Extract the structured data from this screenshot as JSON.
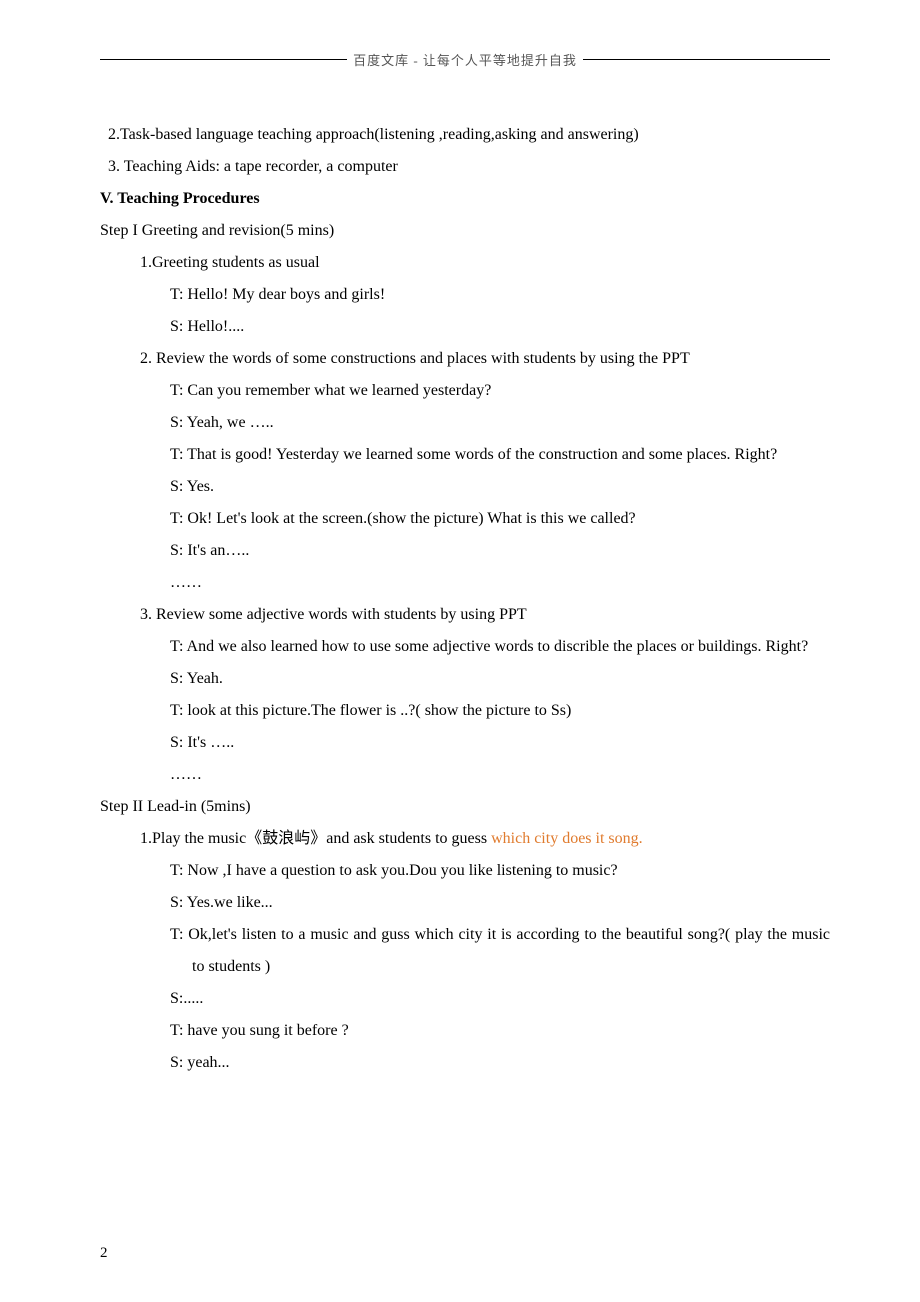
{
  "header": {
    "text": "百度文库 - 让每个人平等地提升自我"
  },
  "lines": {
    "l2": "2.Task-based language teaching approach(listening ,reading,asking and answering)",
    "l3": "3. Teaching Aids: a tape recorder, a computer",
    "sectionV": "V. Teaching Procedures",
    "step1": "Step I    Greeting and revision(5 mins)",
    "s1_1": "1.Greeting students as usual",
    "s1_1_t": "T: Hello! My dear boys and girls!",
    "s1_1_s": "S: Hello!....",
    "s1_2": "2. Review the words of some constructions and places with students by using the PPT",
    "s1_2_t1": "T: Can you remember what we learned yesterday?",
    "s1_2_s1": "S: Yeah, we …..",
    "s1_2_t2": "T: That is good! Yesterday we learned some words of the construction and some places. Right?",
    "s1_2_s2": "S: Yes.",
    "s1_2_t3": "T: Ok! Let's look at the screen.(show the picture)    What is this we called?",
    "s1_2_s3": "S: It's an…..",
    "s1_2_dots": "……",
    "s1_3": "3. Review some adjective words with students by using PPT",
    "s1_3_t1": "T: And we also learned how to use some adjective words to discrible the places or buildings. Right?",
    "s1_3_s1": "S: Yeah.",
    "s1_3_t2": "T: look at this picture.The flower is ..?( show the picture to Ss)",
    "s1_3_s2": "S: It's …..",
    "s1_3_dots": "……",
    "step2": "Step II    Lead-in (5mins)",
    "s2_1_a": "1.Play the music《鼓浪屿》and ask students to guess ",
    "s2_1_b": "which city does it song.",
    "s2_1_t1": "T: Now ,I have a question to ask you.Dou you like listening to music?",
    "s2_1_s1": "S: Yes.we like...",
    "s2_1_t2": "T: Ok,let's listen to a music and guss which city it is according to the beautiful song?( play the music to students )",
    "s2_1_s2": "S:.....",
    "s2_1_t3": "T: have you sung it before ?",
    "s2_1_s3": "S: yeah..."
  },
  "footer": {
    "page": "2"
  }
}
